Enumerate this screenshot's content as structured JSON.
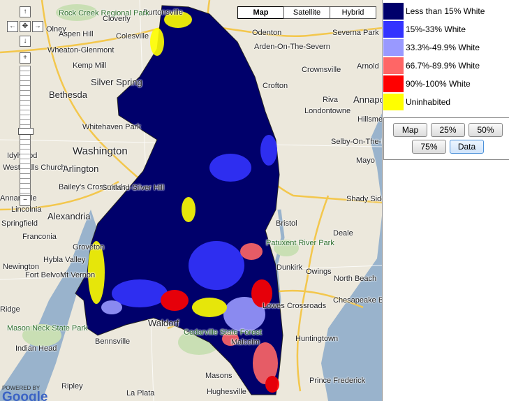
{
  "map_type": {
    "options": [
      "Map",
      "Satellite",
      "Hybrid"
    ],
    "active": "Map"
  },
  "nav": {
    "up": "↑",
    "left": "←",
    "center": "✥",
    "right": "→",
    "down": "↓",
    "zoom_in": "+",
    "zoom_out": "−"
  },
  "attribution": {
    "powered_by": "POWERED BY",
    "logo": "Google"
  },
  "places": [
    "Burtonsville",
    "Rock Creek Regional Park",
    "Olney",
    "Cloverly",
    "Aspen Hill",
    "Colesville",
    "Wheaton-Glenmont",
    "Kemp Mill",
    "Bethesda",
    "Silver Spring",
    "Whitehaven Park",
    "Washington",
    "Arlington",
    "Bailey's Crossroads",
    "Suitland-Silver Hill",
    "Alexandria",
    "Franconia",
    "Springfield",
    "Lincolnia",
    "Annandale",
    "Newington",
    "Fort Belvoir",
    "Hybla Valley",
    "Mt Vernon",
    "Groveton",
    "Mason Neck State Park",
    "Indian Head",
    "Bennsville",
    "Waldorf",
    "Cedarville State Forest",
    "Malcolm",
    "Hughesville",
    "Masons",
    "La Plata",
    "Ripley",
    "Odenton",
    "Arden-On-The-Severn",
    "Severna Park",
    "Arnold",
    "Crownsville",
    "Crofton",
    "Annapolis",
    "Riva",
    "Londontowne",
    "Hillsmere Shores",
    "Selby-On-The-Bay",
    "Mayo",
    "Shady Side",
    "Bristol",
    "Deale",
    "Patuxent River Park",
    "Dunkirk",
    "Owings",
    "North Beach",
    "Chesapeake Beach",
    "Huntingtown",
    "Prince Frederick",
    "Idylwood",
    "West Falls Church",
    "Ridge",
    "Lowes Crossroads"
  ],
  "legend": [
    {
      "label": "Less than 15% White",
      "color": "#00006b"
    },
    {
      "label": "15%-33% White",
      "color": "#3333ff"
    },
    {
      "label": "33.3%-49.9% White",
      "color": "#9999ff"
    },
    {
      "label": "66.7%-89.9% White",
      "color": "#ff6666"
    },
    {
      "label": "90%-100% White",
      "color": "#ff0000"
    },
    {
      "label": "Uninhabited",
      "color": "#ffff00"
    }
  ],
  "controls": {
    "map": "Map",
    "p25": "25%",
    "p50": "50%",
    "p75": "75%",
    "data": "Data"
  }
}
